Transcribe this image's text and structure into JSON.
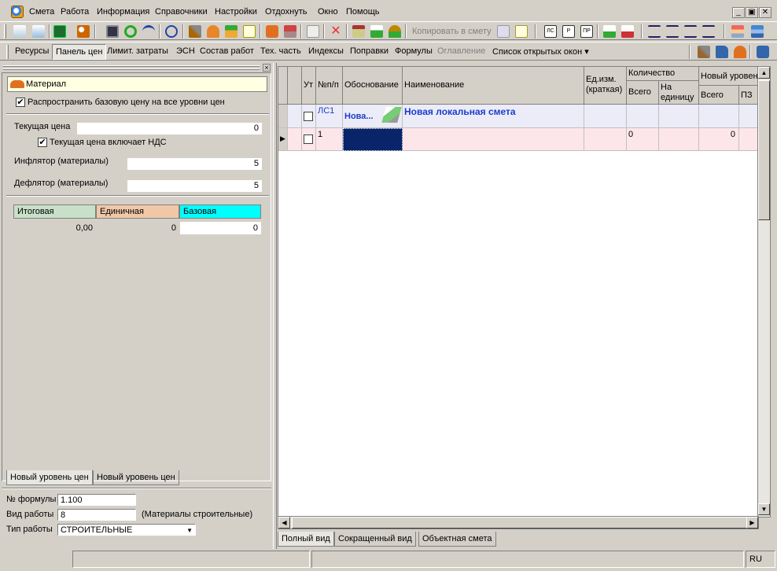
{
  "menu": {
    "items": [
      "Смета",
      "Работа",
      "Информация",
      "Справочники",
      "Настройки",
      "Отдохнуть",
      "Окно",
      "Помощь"
    ],
    "window_controls": [
      "_",
      "▣",
      "✕"
    ]
  },
  "toolbar": {
    "copy_to_estimate": "Копировать в смету",
    "icons": [
      "new-estimate-icon",
      "import-icon",
      "excel-icon",
      "search-icon",
      "save-icon",
      "refresh-icon",
      "undo-icon",
      "redo-icon",
      "tools-icon",
      "crane-icon",
      "resources-icon",
      "comment-icon",
      "bricks-icon",
      "stack-icon",
      "edit-icon",
      "delete-icon",
      "tree-icon",
      "add-icon",
      "export-icon",
      "copy-icon",
      "paste-icon",
      "ls-icon",
      "rs-icon",
      "pr-icon",
      "mark-icon",
      "unmark-icon",
      "indent-icon",
      "outdent-icon",
      "move-up-icon",
      "move-down-icon",
      "books-icon",
      "layers-icon"
    ]
  },
  "tabs_bar": {
    "items": [
      "Ресурсы",
      "Панель цен",
      "Лимит. затраты",
      "ЭСН",
      "Состав работ",
      "Тех. часть",
      "Индексы",
      "Поправки",
      "Формулы",
      "Оглавление",
      "Список открытых окон ▾"
    ],
    "active": "Панель цен"
  },
  "left_panel": {
    "material_label": "Материал",
    "spread_checkbox_label": "Распространить базовую цену на все уровни цен",
    "spread_checked": true,
    "current_price_label": "Текущая цена",
    "current_price_value": "0",
    "vat_checkbox_label": "Текущая цена включает НДС",
    "vat_checked": true,
    "inflator_label": "Инфлятор (материалы)",
    "inflator_value": "5",
    "deflator_label": "Дефлятор (материалы)",
    "deflator_value": "5",
    "price_headers": [
      "Итоговая",
      "Единичная",
      "Базовая"
    ],
    "price_values": [
      "0,00",
      "0",
      "0"
    ],
    "price_colors": [
      "#c8e0c8",
      "#f0c8a8",
      "#00ffff"
    ],
    "bottom_tabs": [
      "Новый уровень цен",
      "Новый уровень цен"
    ],
    "formula_no_label": "№ формулы",
    "formula_no_value": "1.100",
    "work_type_label": "Вид работы",
    "work_type_value": "8",
    "work_type_desc": "(Материалы строительные)",
    "work_kind_label": "Тип работы",
    "work_kind_value": "СТРОИТЕЛЬНЫЕ"
  },
  "grid": {
    "headers": {
      "ut": "Ут",
      "num": "№п/п",
      "basis": "Обоснование",
      "name": "Наименование",
      "unit": "Ед.изм. (краткая)",
      "quantity": "Количество",
      "total": "Всего",
      "per_unit": "На единицу",
      "new_level": "Новый уровень",
      "new_total": "Всего",
      "pz": "ПЗ"
    },
    "rows": [
      {
        "num": "ЛС1",
        "basis": "Нова...",
        "name": "Новая локальная смета",
        "qty_total": "",
        "new_total": ""
      },
      {
        "num": "1",
        "basis": "",
        "name": "",
        "qty_total": "0",
        "new_total": "0"
      }
    ]
  },
  "view_tabs": [
    "Полный вид",
    "Сокращенный вид",
    "Объектная смета"
  ],
  "status": {
    "lang": "RU"
  }
}
